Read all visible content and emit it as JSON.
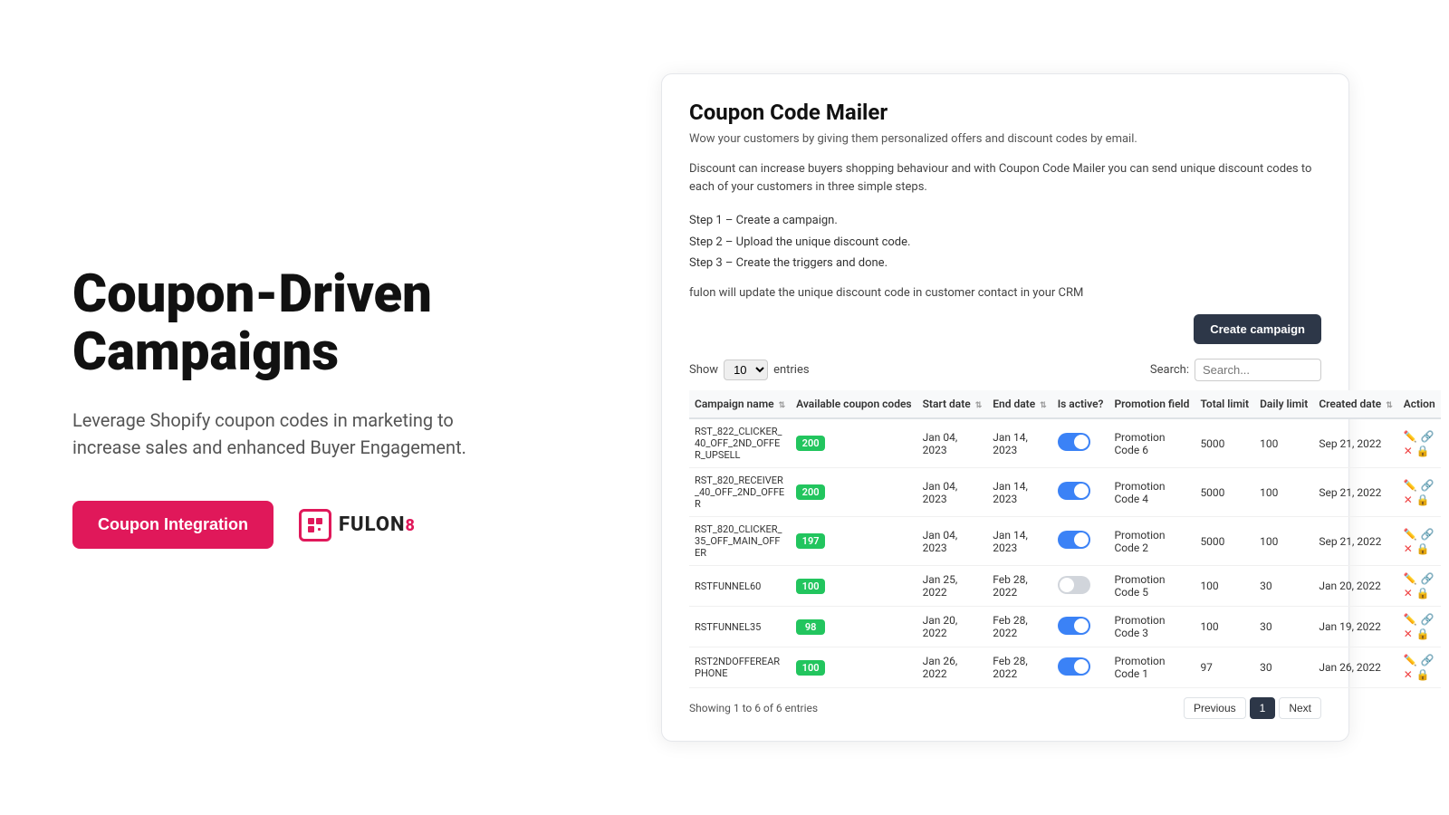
{
  "left": {
    "hero_title": "Coupon-Driven Campaigns",
    "hero_subtitle": "Leverage Shopify coupon codes in marketing to increase sales and enhanced Buyer Engagement.",
    "cta_label": "Coupon Integration",
    "logo_text": "FULON",
    "logo_suffix": "8"
  },
  "right": {
    "app_title": "Coupon Code Mailer",
    "app_tagline": "Wow your customers by giving them personalized offers and discount codes by email.",
    "app_desc": "Discount can increase buyers shopping behaviour and with Coupon Code Mailer you can send unique discount codes to each of your customers in three simple steps.",
    "steps": [
      "Step 1 – Create a campaign.",
      "Step 2 – Upload the unique discount code.",
      "Step 3 – Create the triggers and done."
    ],
    "app_note": "fulon will update the unique discount code in customer contact in your CRM",
    "create_btn": "Create campaign",
    "show_label": "Show",
    "entries_value": "10",
    "entries_label": "entries",
    "search_label": "Search:",
    "search_placeholder": "Search...",
    "table": {
      "headers": [
        "Campaign name",
        "Available coupon codes",
        "Start date",
        "End date",
        "Is active?",
        "Promotion field",
        "Total limit",
        "Daily limit",
        "Created date",
        "Action"
      ],
      "rows": [
        {
          "name": "RST_822_CLICKER_40_OFF_2ND_OFFER_UPSELL",
          "codes": "200",
          "start": "Jan 04, 2023",
          "end": "Jan 14, 2023",
          "active": true,
          "promo": "Promotion Code 6",
          "total": "5000",
          "daily": "100",
          "created": "Sep 21, 2022"
        },
        {
          "name": "RST_820_RECEIVER_40_OFF_2ND_OFFER",
          "codes": "200",
          "start": "Jan 04, 2023",
          "end": "Jan 14, 2023",
          "active": true,
          "promo": "Promotion Code 4",
          "total": "5000",
          "daily": "100",
          "created": "Sep 21, 2022"
        },
        {
          "name": "RST_820_CLICKER_35_OFF_MAIN_OFFER",
          "codes": "197",
          "start": "Jan 04, 2023",
          "end": "Jan 14, 2023",
          "active": true,
          "promo": "Promotion Code 2",
          "total": "5000",
          "daily": "100",
          "created": "Sep 21, 2022"
        },
        {
          "name": "RSTFUNNEL60",
          "codes": "100",
          "start": "Jan 25, 2022",
          "end": "Feb 28, 2022",
          "active": false,
          "promo": "Promotion Code 5",
          "total": "100",
          "daily": "30",
          "created": "Jan 20, 2022"
        },
        {
          "name": "RSTFUNNEL35",
          "codes": "98",
          "start": "Jan 20, 2022",
          "end": "Feb 28, 2022",
          "active": true,
          "promo": "Promotion Code 3",
          "total": "100",
          "daily": "30",
          "created": "Jan 19, 2022"
        },
        {
          "name": "RST2NDOFFEREARPHONE",
          "codes": "100",
          "start": "Jan 26, 2022",
          "end": "Feb 28, 2022",
          "active": true,
          "promo": "Promotion Code 1",
          "total": "97",
          "daily": "30",
          "created": "Jan 26, 2022"
        }
      ]
    },
    "footer_showing": "Showing 1 to 6 of 6 entries",
    "pagination": {
      "prev": "Previous",
      "current": "1",
      "next": "Next"
    }
  }
}
